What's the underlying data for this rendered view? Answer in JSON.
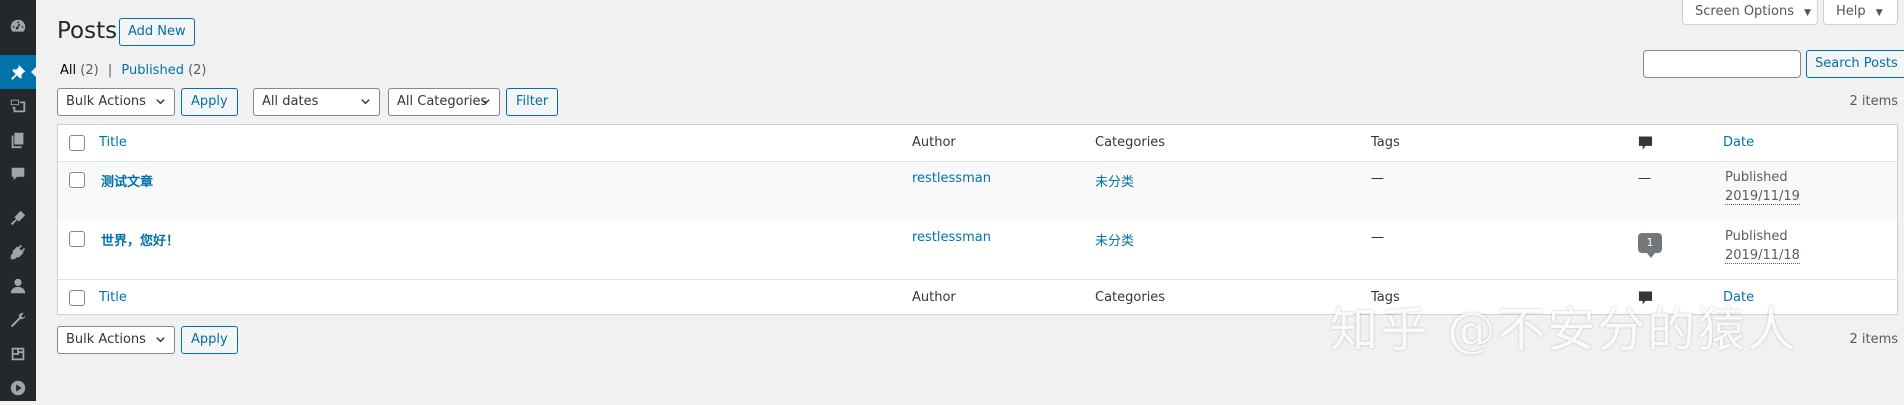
{
  "sidebar": {
    "items": [
      {
        "icon": "dashboard-icon"
      },
      {
        "icon": "pin-icon",
        "current": true
      },
      {
        "icon": "media-icon"
      },
      {
        "icon": "pages-icon"
      },
      {
        "icon": "comments-icon"
      },
      {
        "icon": "appearance-icon"
      },
      {
        "icon": "plugins-icon"
      },
      {
        "icon": "users-icon"
      },
      {
        "icon": "tools-icon"
      },
      {
        "icon": "settings-icon"
      },
      {
        "icon": "play-icon"
      }
    ]
  },
  "header": {
    "title": "Posts",
    "add_new": "Add New",
    "screen_options": "Screen Options",
    "help": "Help"
  },
  "subsubsub": {
    "all_label": "All",
    "all_count": "(2)",
    "separator": "|",
    "published_label": "Published",
    "published_count": "(2)"
  },
  "search": {
    "value": "",
    "button": "Search Posts"
  },
  "tablenav_top": {
    "bulk_actions": "Bulk Actions",
    "apply": "Apply",
    "dates": "All dates",
    "categories": "All Categories",
    "filter": "Filter",
    "items_count": "2 items"
  },
  "table": {
    "columns": {
      "title": "Title",
      "author": "Author",
      "categories": "Categories",
      "tags": "Tags",
      "date": "Date"
    },
    "rows": [
      {
        "title": "测试文章",
        "author": "restlessman",
        "categories": "未分类",
        "tags": "—",
        "comments": "—",
        "status": "Published",
        "date": "2019/11/19"
      },
      {
        "title": "世界，您好！",
        "author": "restlessman",
        "categories": "未分类",
        "tags": "—",
        "comments": "1",
        "status": "Published",
        "date": "2019/11/18"
      }
    ]
  },
  "tablenav_bottom": {
    "bulk_actions": "Bulk Actions",
    "apply": "Apply",
    "items_count": "2 items"
  },
  "watermark": "知乎 @不安分的猿人",
  "colors": {
    "sidebar_bg": "#23282d",
    "accent": "#0073aa",
    "page_bg": "#f1f1f1"
  }
}
